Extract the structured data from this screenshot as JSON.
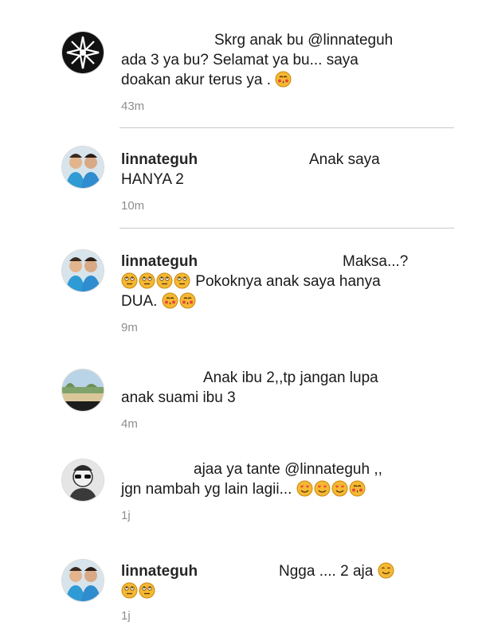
{
  "comments": [
    {
      "avatar_icon": "starburst-avatar",
      "username": "",
      "line1": "Skrg anak bu @linnateguh",
      "line2": "ada 3 ya bu? Selamat ya bu... saya",
      "line3": "doakan akur terus ya .",
      "time": "43m"
    },
    {
      "avatar_icon": "couple-photo-avatar",
      "username": "linnateguh",
      "line1": "Anak saya",
      "line2": "HANYA 2",
      "time": "10m"
    },
    {
      "avatar_icon": "couple-photo-avatar",
      "username": "linnateguh",
      "line1": "Maksa...?",
      "line2": "Pokoknya anak saya hanya",
      "line3": "DUA.",
      "time": "9m"
    },
    {
      "avatar_icon": "landscape-avatar",
      "username": "",
      "line1": "Anak ibu 2,,tp jangan lupa",
      "line2": "anak suami ibu 3",
      "time": "4m"
    },
    {
      "avatar_icon": "sunglasses-person-avatar",
      "username": "",
      "line1": "ajaa ya tante @linnateguh ,,",
      "line2": "jgn nambah yg lain lagii...",
      "time": "1j"
    },
    {
      "avatar_icon": "couple-photo-avatar",
      "username": "linnateguh",
      "line1": "Ngga .... 2 aja",
      "time": "1j"
    }
  ],
  "colors": {
    "text": "#1a1a1a",
    "timestamp": "#8e8e8e",
    "divider": "#c9c9c9",
    "emoji_face": "#f5b833",
    "emoji_cheek": "#e8473c"
  }
}
